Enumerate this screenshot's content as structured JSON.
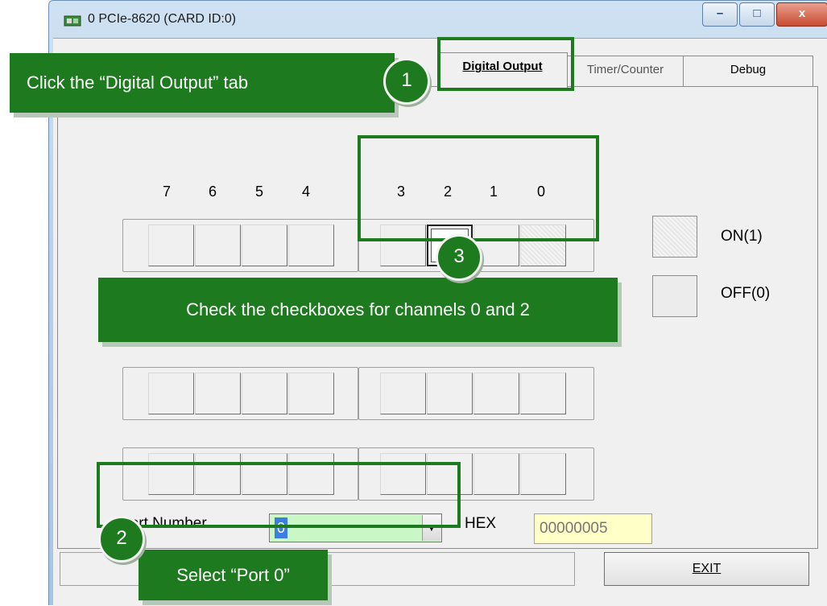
{
  "window": {
    "title": "0 PCIe-8620 (CARD ID:0)",
    "minimize_icon": "minimize-icon",
    "maximize_icon": "maximize-icon",
    "close_icon": "close-icon",
    "minimize_glyph": "–",
    "maximize_glyph": "□",
    "close_glyph": "x"
  },
  "tabs": [
    {
      "label": "Digital Output",
      "active": true
    },
    {
      "label": "Timer/Counter",
      "active": false
    },
    {
      "label": "Debug",
      "active": false
    }
  ],
  "bits": {
    "high_labels": [
      "7",
      "6",
      "5",
      "4"
    ],
    "low_labels": [
      "3",
      "2",
      "1",
      "0"
    ],
    "row1_low_states": [
      "off",
      "checked",
      "off",
      "on"
    ]
  },
  "legend": {
    "on_label": "ON(1)",
    "off_label": "OFF(0)"
  },
  "port": {
    "label": "Port Number",
    "selected": "0",
    "hex_label": "HEX",
    "hex_value": "00000005",
    "dropdown_glyph": "▼"
  },
  "exit_label": "EXIT",
  "annotations": {
    "step1": {
      "number": "1",
      "text": "Click the “Digital Output” tab"
    },
    "step2": {
      "number": "2",
      "text": "Select “Port 0”"
    },
    "step3": {
      "number": "3",
      "text": "Check the checkboxes for channels 0 and 2"
    }
  },
  "colors": {
    "annotation_green": "#1e7a1e",
    "combo_background": "#c9f7c6",
    "hex_background": "#ffffc8",
    "selection_blue": "#3d7ee0"
  }
}
